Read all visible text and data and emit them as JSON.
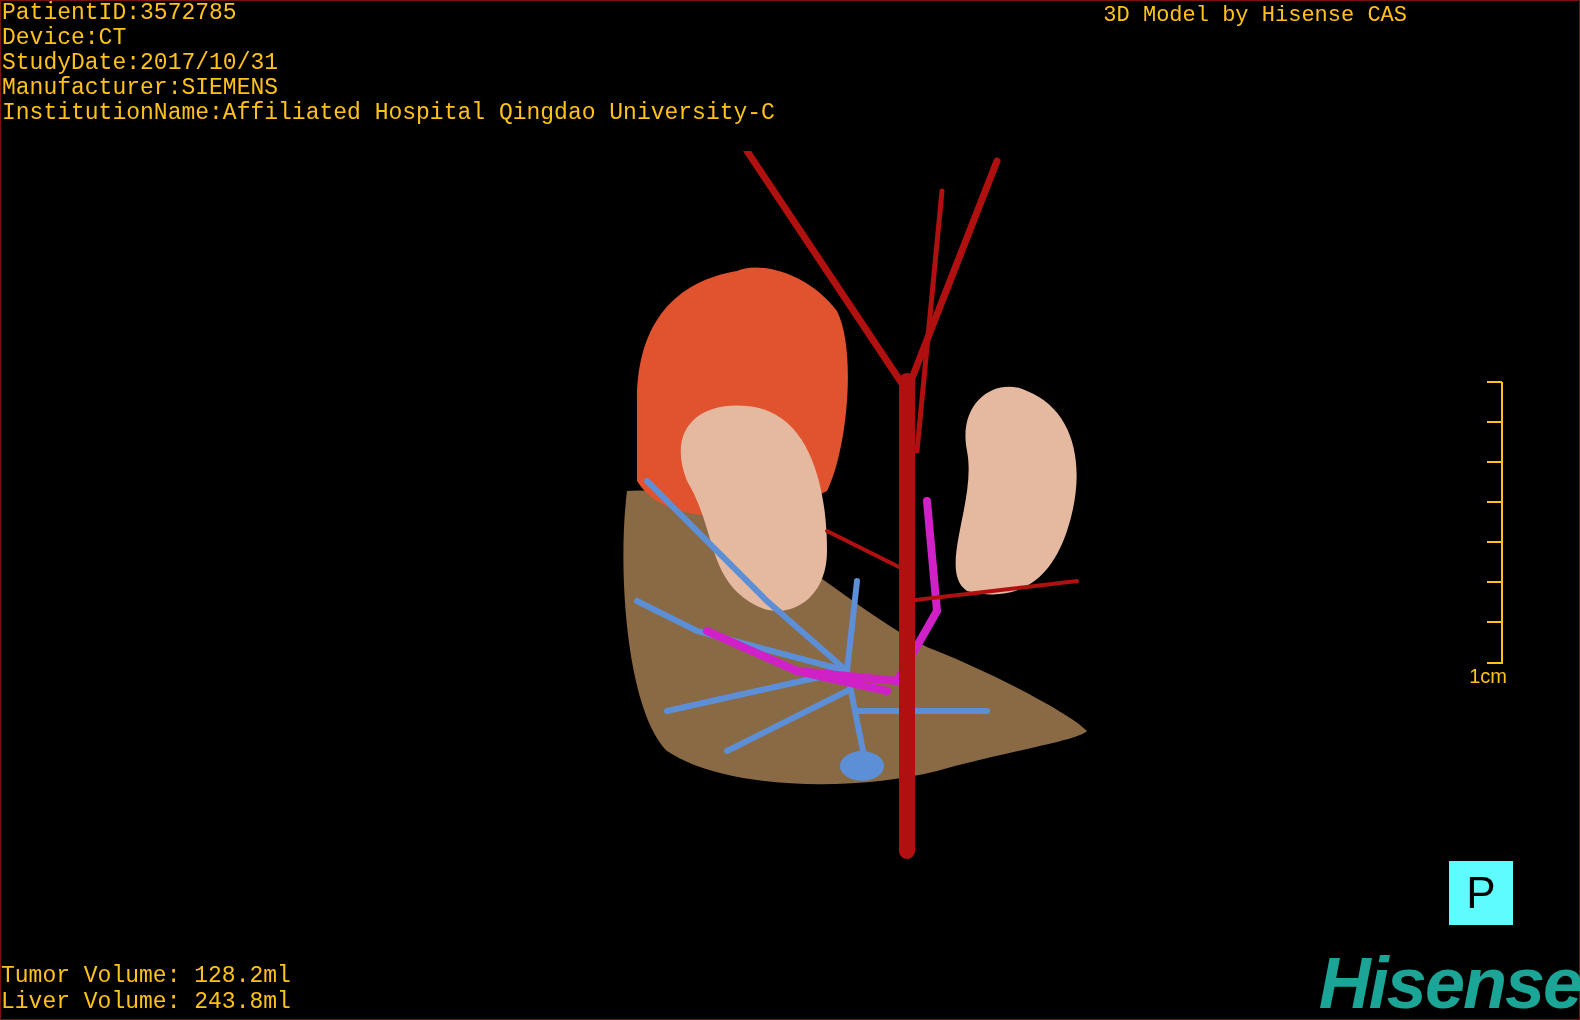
{
  "info_lines": [
    "PatientID:3572785",
    "Device:CT",
    "StudyDate:2017/10/31",
    "Manufacturer:SIEMENS",
    "InstitutionName:Affiliated Hospital Qingdao University-C"
  ],
  "title": "3D Model by Hisense CAS",
  "scale_bar": {
    "label": "1cm"
  },
  "orientation_marker": "P",
  "volumes": [
    "Tumor Volume: 128.2ml",
    "Liver Volume: 243.8ml"
  ],
  "logo": "Hisense"
}
